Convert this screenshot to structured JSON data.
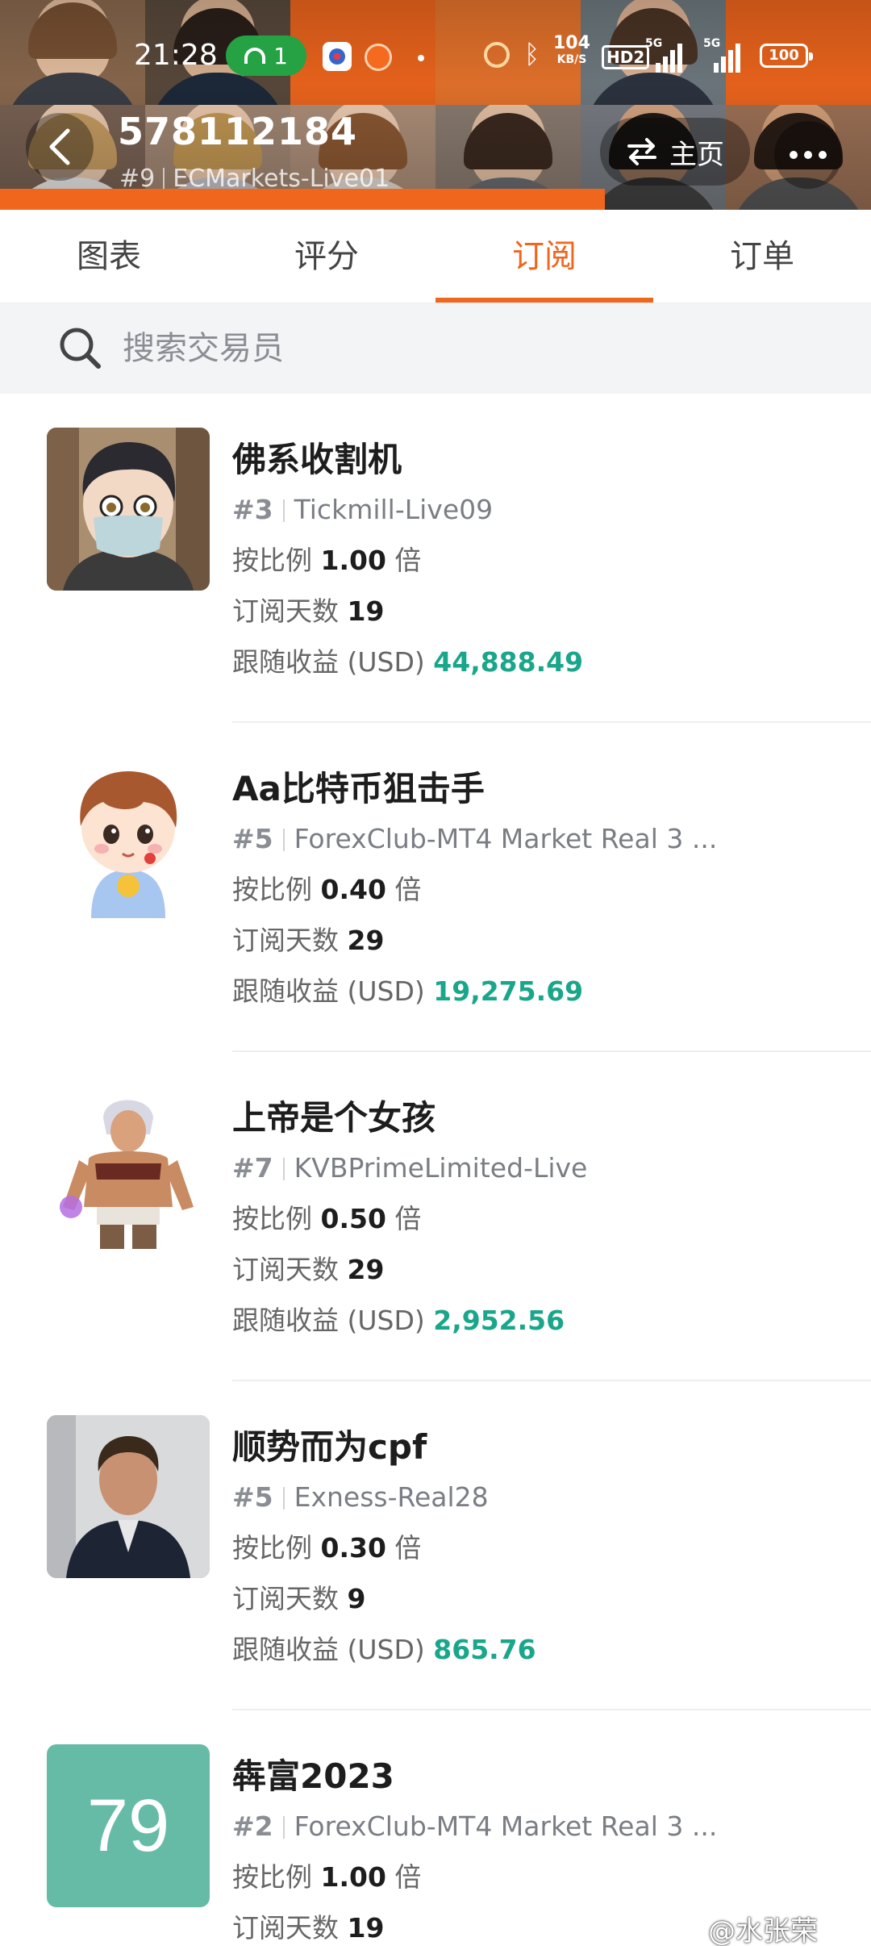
{
  "status_bar": {
    "time": "21:28",
    "network_count": "1",
    "speed_value": "104",
    "speed_unit": "KB/S",
    "hd_label": "HD2",
    "signal1_label": "5G",
    "signal2_label": "5G",
    "battery": "100"
  },
  "header": {
    "trader_id": "578112184",
    "rank": "#9",
    "server": "ECMarkets-Live01",
    "home_label": "主页",
    "back_icon": "chevron-left-icon",
    "home_icon": "swap-arrows-icon",
    "more_icon": "more-dots-icon",
    "accent_color": "#f0661d"
  },
  "tabs": [
    {
      "label": "图表",
      "active": false
    },
    {
      "label": "评分",
      "active": false
    },
    {
      "label": "订阅",
      "active": true
    },
    {
      "label": "订单",
      "active": false
    }
  ],
  "search": {
    "placeholder": "搜索交易员",
    "value": "",
    "icon": "search-icon"
  },
  "labels": {
    "ratio_prefix": "按比例",
    "ratio_suffix": "倍",
    "days_prefix": "订阅天数",
    "profit_prefix": "跟随收益 (USD)"
  },
  "subscriptions": [
    {
      "name": "佛系收割机",
      "rank": "#3",
      "server": "Tickmill-Live09",
      "ratio": "1.00",
      "days": "19",
      "profit": "44,888.49",
      "avatar": "masked-person-avatar"
    },
    {
      "name": "Aa比特币狙击手",
      "rank": "#5",
      "server": "ForexClub-MT4 Market Real 3 ...",
      "ratio": "0.40",
      "days": "29",
      "profit": "19,275.69",
      "avatar": "cartoon-boy-avatar"
    },
    {
      "name": "上帝是个女孩",
      "rank": "#7",
      "server": "KVBPrimeLimited-Live",
      "ratio": "0.50",
      "days": "29",
      "profit": "2,952.56",
      "avatar": "game-character-avatar"
    },
    {
      "name": "顺势而为cpf",
      "rank": "#5",
      "server": "Exness-Real28",
      "ratio": "0.30",
      "days": "9",
      "profit": "865.76",
      "avatar": "man-in-suit-avatar"
    },
    {
      "name": "犇富2023",
      "rank": "#2",
      "server": "ForexClub-MT4 Market Real 3 ...",
      "ratio": "1.00",
      "days": "19",
      "profit": "",
      "avatar_text": "79"
    }
  ],
  "watermark": "@水张荣",
  "colors": {
    "profit": "#1aa68a",
    "tab_active": "#f0661d",
    "number_avatar_bg": "#66bba7"
  }
}
